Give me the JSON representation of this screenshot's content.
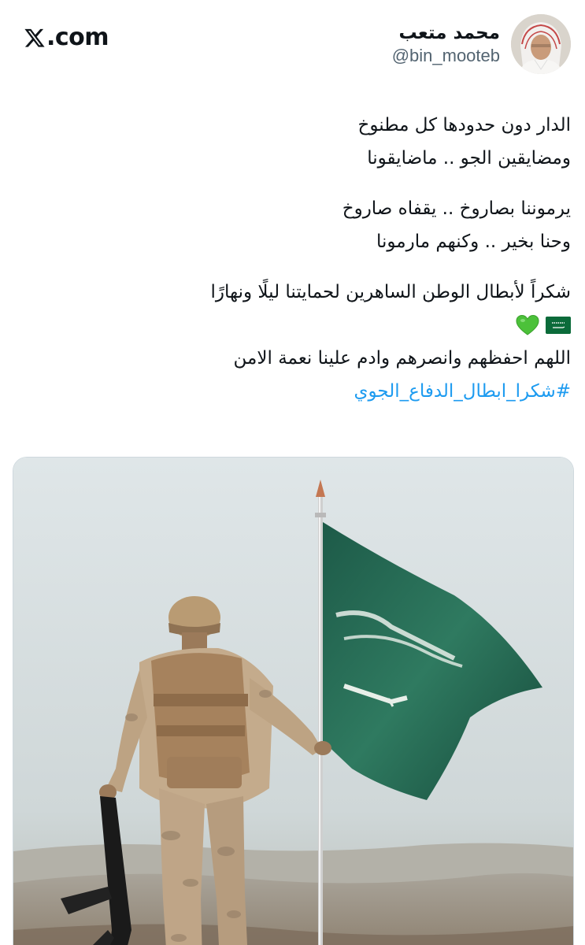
{
  "brand": {
    "label": "X.com",
    "label_suffix": ".com"
  },
  "author": {
    "name": "محمد متعب",
    "handle": "@bin_mooteb"
  },
  "tweet": {
    "lines": [
      "الدار دون حدودها كل مطنوخ",
      "ومضايقين الجو .. ماضايقونا",
      "يرموننا بصاروخ .. يقفاه صاروخ",
      "وحنا بخير .. وكنهم مارمونا",
      "شكراً لأبطال الوطن الساهرين لحمايتنا ليلًا ونهارًا",
      "اللهم احفظهم وانصرهم وادم علينا نعمة الامن"
    ],
    "emojis": [
      "saudi-flag",
      "green-heart"
    ],
    "hashtag": "#شكرا_ابطال_الدفاع_الجوي"
  },
  "colors": {
    "hashtag": "#1d9bf0",
    "handle": "#536471",
    "flag_green": "#0b6b3a",
    "heart_green": "#4cc13a"
  },
  "media": {
    "image": "soldier-with-saudi-flag"
  }
}
